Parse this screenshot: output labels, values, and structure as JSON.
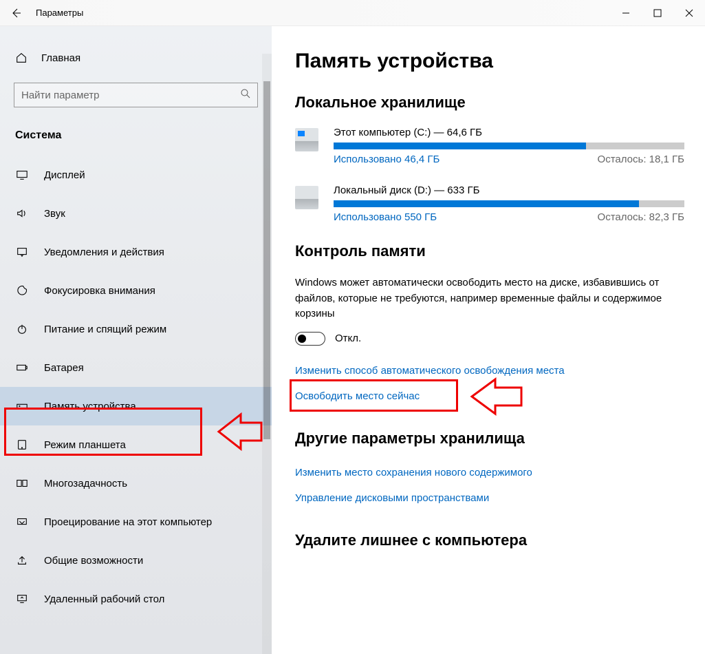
{
  "window": {
    "title": "Параметры"
  },
  "sidebar": {
    "home": "Главная",
    "search_placeholder": "Найти параметр",
    "group": "Система",
    "items": [
      {
        "id": "display",
        "label": "Дисплей"
      },
      {
        "id": "sound",
        "label": "Звук"
      },
      {
        "id": "notifications",
        "label": "Уведомления и действия"
      },
      {
        "id": "focus",
        "label": "Фокусировка внимания"
      },
      {
        "id": "power",
        "label": "Питание и спящий режим"
      },
      {
        "id": "battery",
        "label": "Батарея"
      },
      {
        "id": "storage",
        "label": "Память устройства"
      },
      {
        "id": "tablet",
        "label": "Режим планшета"
      },
      {
        "id": "multitask",
        "label": "Многозадачность"
      },
      {
        "id": "project",
        "label": "Проецирование на этот компьютер"
      },
      {
        "id": "shared",
        "label": "Общие возможности"
      },
      {
        "id": "remote",
        "label": "Удаленный рабочий стол"
      }
    ]
  },
  "page": {
    "title": "Память устройства",
    "local_heading": "Локальное хранилище",
    "drives": [
      {
        "title": "Этот компьютер (C:) — 64,6 ГБ",
        "used_label": "Использовано 46,4 ГБ",
        "free_label": "Осталось: 18,1 ГБ",
        "fill_pct": 72
      },
      {
        "title": "Локальный диск (D:) — 633 ГБ",
        "used_label": "Использовано 550 ГБ",
        "free_label": "Осталось: 82,3 ГБ",
        "fill_pct": 87
      }
    ],
    "sense_heading": "Контроль памяти",
    "sense_body": "Windows может автоматически освободить место на диске, избавившись от файлов, которые не требуются, например временные файлы и содержимое корзины",
    "toggle_state": "Откл.",
    "link_configure": "Изменить способ автоматического освобождения места",
    "link_freeup": "Освободить место сейчас",
    "other_heading": "Другие параметры хранилища",
    "link_save_loc": "Изменить место сохранения нового содержимого",
    "link_spaces": "Управление дисковыми пространствами",
    "cleanup_heading": "Удалите лишнее с компьютера"
  }
}
